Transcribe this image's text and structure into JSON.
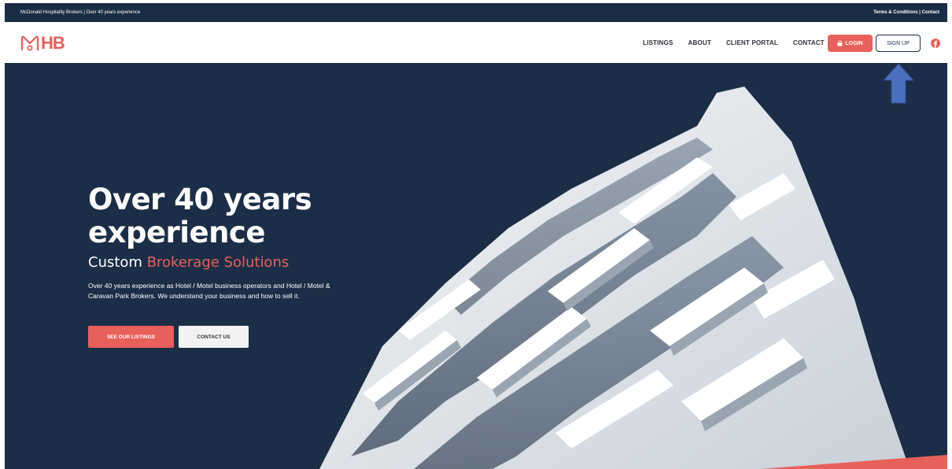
{
  "topbar": {
    "left_text": "McDonald Hospitality Brokers | Over 40 years experience",
    "terms_link": "Terms & Conditions",
    "separator": " | ",
    "contact_link": "Contact"
  },
  "brand": {
    "logo_text": "HB",
    "accent_color": "#e8605a",
    "navy_color": "#1b2c45"
  },
  "nav": {
    "items": [
      {
        "label": "LISTINGS"
      },
      {
        "label": "ABOUT"
      },
      {
        "label": "CLIENT PORTAL"
      },
      {
        "label": "CONTACT"
      }
    ],
    "login_label": "LOGIN",
    "signup_label": "SIGN UP",
    "social_icon": "facebook-icon"
  },
  "hero": {
    "title_line1": "Over 40 years",
    "title_line2": "experience",
    "subtitle_plain": "Custom ",
    "subtitle_accent": "Brokerage Solutions",
    "description": "Over 40 years experience as Hotel / Motel business operators and Hotel / Motel & Caravan Park Brokers. We understand your business and how to sell it.",
    "primary_button": "SEE OUR LISTINGS",
    "secondary_button": "CONTACT US"
  },
  "annotation": {
    "arrow_icon": "up-arrow-icon",
    "arrow_color": "#4a6fbd"
  }
}
